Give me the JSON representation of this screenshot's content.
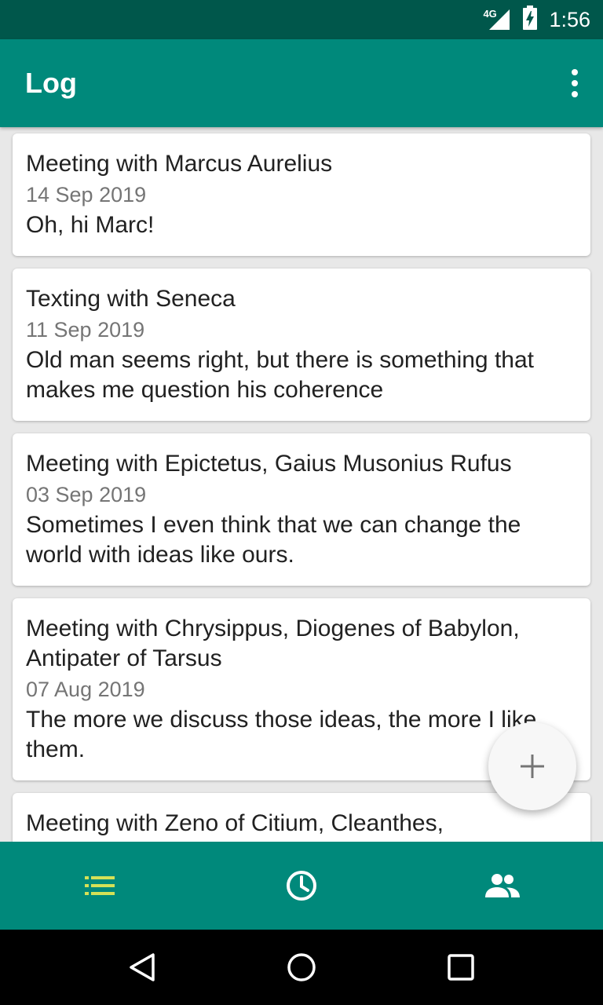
{
  "status_bar": {
    "network": "4G",
    "time": "1:56"
  },
  "app_bar": {
    "title": "Log"
  },
  "entries": [
    {
      "title": "Meeting with Marcus Aurelius",
      "date": "14 Sep 2019",
      "note": "Oh, hi Marc!"
    },
    {
      "title": "Texting with Seneca",
      "date": "11 Sep 2019",
      "note": "Old man seems right, but there is something that makes me question his coherence"
    },
    {
      "title": "Meeting with Epictetus, Gaius Musonius Rufus",
      "date": "03 Sep 2019",
      "note": "Sometimes I even think that we can change the world with ideas like ours."
    },
    {
      "title": "Meeting with Chrysippus, Diogenes of Babylon, Antipater of Tarsus",
      "date": "07 Aug 2019",
      "note": "The more we discuss those ideas, the more I like them."
    },
    {
      "title": "Meeting with Zeno of Citium, Cleanthes,",
      "date": "",
      "note": ""
    }
  ],
  "bottom_nav": [
    {
      "icon": "list-icon",
      "active": true
    },
    {
      "icon": "clock-icon",
      "active": false
    },
    {
      "icon": "people-icon",
      "active": false
    }
  ],
  "colors": {
    "primary": "#00897b",
    "primary_dark": "#00574b",
    "accent_active": "#d4e157",
    "inactive_icon": "#ffffff"
  }
}
